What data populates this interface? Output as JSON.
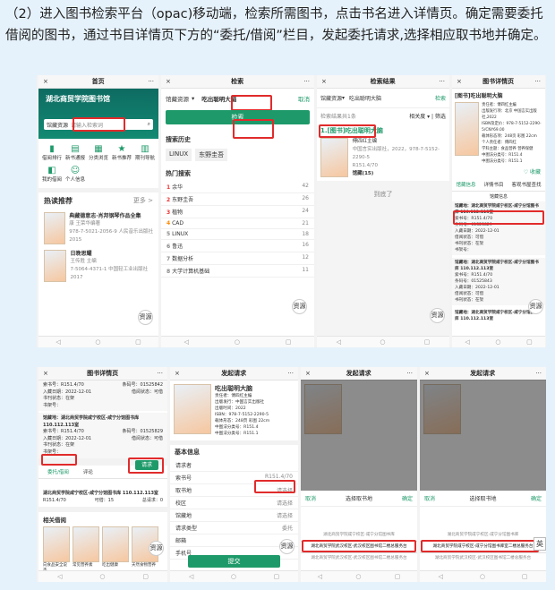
{
  "instruction": "（2）进入图书检索平台（opac)移动端，检索所需图书，点击书名进入详情页。确定需要委托借阅的图书，通过书目详情页下方的“委托/借阅”栏目，发起委托请求,选择相应取书地并确定。",
  "common": {
    "close": "×",
    "more": "···",
    "floating_label": "资源"
  },
  "s1": {
    "home": {
      "title": "首页",
      "banner": "湖北商贸学院图书馆",
      "search_type": "馆藏资源",
      "search_placeholder": "请输入检索词",
      "icons": [
        "借阅排行",
        "新书通报",
        "分类浏览",
        "新书推荐",
        "期刊导航",
        "我的借阅",
        "个人信息"
      ],
      "section_title": "热读推荐",
      "section_more": "更多 >",
      "books": [
        {
          "title": "典藏德意志·肖邦钢琴作品全集",
          "meta": "康 王荣华编著",
          "isbn": "978-7-5021-2056-9 人民音乐出版社 2015"
        },
        {
          "title": "日晚思耀",
          "meta": "王传胜 主编",
          "isbn": "7-5064-4371-1 中国轻工业出版社 2017"
        }
      ]
    },
    "search": {
      "title": "检索",
      "type": "馆藏资源",
      "query": "吃出聪明大脑",
      "cancel": "取消",
      "button": "检索",
      "history_title": "搜索历史",
      "history": [
        "LINUX",
        "东野圭吾"
      ],
      "hot_title": "热门搜索",
      "hot": [
        {
          "rank": "1",
          "word": "余华",
          "count": "42"
        },
        {
          "rank": "2",
          "word": "东野圭吾",
          "count": "26"
        },
        {
          "rank": "3",
          "word": "植物",
          "count": "24"
        },
        {
          "rank": "4",
          "word": "CAD",
          "count": "21"
        },
        {
          "rank": "5",
          "word": "LINUX",
          "count": "18"
        },
        {
          "rank": "6",
          "word": "鲁迅",
          "count": "16"
        },
        {
          "rank": "7",
          "word": "数据分析",
          "count": "12"
        },
        {
          "rank": "8",
          "word": "大学计算机基础",
          "count": "11"
        }
      ]
    },
    "results": {
      "title": "检索结果",
      "type": "馆藏资源",
      "query": "吃出聪明大脑",
      "search": "检索",
      "count": "检索结果共1条",
      "sort": "相关度",
      "filter": "筛选",
      "item_title": "1.[图书]吃出聪明大脑",
      "item_author": "傅四红主编",
      "item_pub": "中国言实出版社，2022，978-7-5152-2290-5",
      "item_call": "R151.4/70",
      "item_copies": "馆藏(15)",
      "end": "到底了"
    },
    "detail": {
      "title": "图书详情页",
      "book_title": "[图书]吃出聪明大脑",
      "lines": [
        "责任者：傅四红主编",
        "出版发行项：北京 中国言实出版社,2022",
        "ISBN及定价：978-7-5152-2290-5/CNY69.00",
        "载体形态项：248页 彩图 22cm",
        "个人责任者：傅四红",
        "学科主题：食品营养 营养保健",
        "中图法分类号：R151.4",
        "中图法分类号：R151.1"
      ],
      "collect": "收藏",
      "tabs": [
        "馆藏信息",
        "详情书目",
        "客观书屋查找"
      ],
      "sub_tab": "馆藏信息",
      "holdings": [
        {
          "loc": "馆藏地：湖北商贸学院咸宁校区-咸宁分馆图书库 110.112.113室",
          "call": "索书号：R151.4/70",
          "barcode": "条码号：01525829",
          "in_date": "入藏日期：2022-12-01",
          "status": "借阅状态：可借",
          "place": "书刊状态：在架",
          "shelf": "书架号："
        },
        {
          "loc": "馆藏地：湖北商贸学院咸宁校区-咸宁分馆图书库 110.112.113室",
          "call": "索书号：R151.4/70",
          "barcode": "条码号：01525843",
          "in_date": "入藏日期：2022-12-01",
          "status": "借阅状态：可借",
          "place": "书刊状态：在架",
          "shelf": "书架号："
        },
        {
          "loc": "馆藏地：湖北商贸学院咸宁校区-咸宁分馆图书库 110.112.113室"
        }
      ]
    }
  },
  "s2": {
    "detail2": {
      "title": "图书详情页",
      "rows": [
        {
          "a": "索书号：R151.4/70",
          "b": "条码号：01525842"
        },
        {
          "a": "入藏日期：2022-12-01",
          "b": "借阅状态：可借"
        },
        {
          "a": "书刊状态：在架",
          "b": ""
        },
        {
          "a": "书架号：",
          "b": ""
        }
      ],
      "loc": "馆藏地：湖北商贸学院咸宁校区-咸宁分馆图书库 110.112.113室",
      "rows2": [
        {
          "a": "索书号：R151.4/70",
          "b": "条码号：01525829"
        },
        {
          "a": "入藏日期：2022-12-01",
          "b": "借阅状态：可借"
        },
        {
          "a": "书刊状态：在架",
          "b": ""
        },
        {
          "a": "书架号：",
          "b": ""
        }
      ],
      "tabs": [
        "委托/借阅",
        "评论"
      ],
      "request_btn": "请求",
      "req_loc": "湖北商贸学院咸宁校区-咸宁分馆图书库 110.112.113室",
      "req_call": "R151.4/70",
      "req_copies": "可借：15",
      "req_total": "总请求：0",
      "recommend": "相关借阅",
      "rec_books": [
        "向食品安全说不",
        "常见营养素",
        "吃出健康",
        "天然食物营养"
      ]
    },
    "request": {
      "title": "发起请求",
      "book_title": "吃出聪明大脑",
      "lines": [
        "责任者：傅四红主编",
        "出版发行：中国言实出版社",
        "出版时间：2022",
        "ISBN：978-7-5152-2290-5",
        "载体形态：248页 彩图 22cm",
        "中图法分类号：R151.4",
        "中图法分类号：R151.1"
      ],
      "section": "基本信息",
      "fields": [
        {
          "label": "请求者",
          "value": ""
        },
        {
          "label": "索书号",
          "value": "R151.4/70"
        },
        {
          "label": "取书地",
          "value": "请选择"
        },
        {
          "label": "校区",
          "value": "请选择"
        },
        {
          "label": "馆藏地",
          "value": "请选择"
        },
        {
          "label": "请求类型",
          "value": "委托"
        },
        {
          "label": "邮箱",
          "value": ""
        },
        {
          "label": "手机号",
          "value": ""
        }
      ],
      "submit": "提交"
    },
    "picker_a": {
      "title": "发起请求",
      "cancel": "取消",
      "picker_title": "选择取书地",
      "confirm": "确定",
      "options": [
        "湖北商贸学院武汉校区-武汉校区图书馆二楼总服务台",
        "湖北商贸学院咸宁校区-咸宁分馆图书库",
        "湖北商贸学院武汉校区-武汉校区图书馆二楼总服务台"
      ]
    },
    "picker_b": {
      "title": "发起请求",
      "cancel": "取消",
      "picker_title": "选择取书地",
      "confirm": "确定",
      "options": [
        "湖北商贸学院武汉校区-武汉校区图书馆二楼总服务台",
        "湖北商贸学院咸宁校区-咸宁分馆图书库室二楼总服务台",
        "湖北商贸学院咸宁校区-咸宁分馆图书库"
      ],
      "ime": "英"
    }
  }
}
